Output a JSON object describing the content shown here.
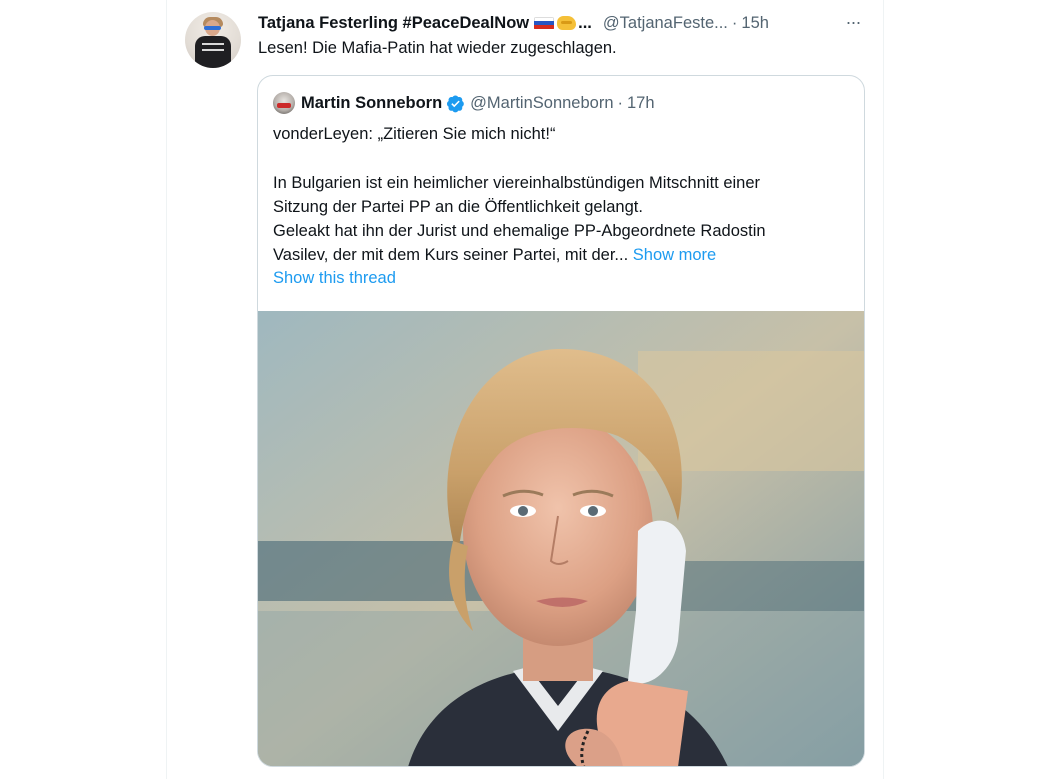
{
  "tweet": {
    "author": {
      "display_name": "Tatjana Festerling #PeaceDealNow",
      "name_emoji": [
        "russia-flag",
        "handshake"
      ],
      "name_truncation": "...",
      "handle": "@TatjanaFeste...",
      "separator": "·",
      "time": "15h"
    },
    "more_icon": "···",
    "text": "Lesen! Die Mafia-Patin hat wieder zugeschlagen."
  },
  "quoted_tweet": {
    "author": {
      "display_name": "Martin Sonneborn",
      "verified": true,
      "handle": "@MartinSonneborn",
      "separator": "·",
      "time": "17h"
    },
    "lines": [
      "vonderLeyen: „Zitieren Sie mich nicht!“",
      "",
      "In Bulgarien ist ein heimlicher viereinhalbstündigen Mitschnitt einer",
      "Sitzung der Partei PP an die Öffentlichkeit gelangt.",
      "Geleakt hat ihn der Jurist und ehemalige PP-Abgeordnete Radostin",
      "Vasilev, der mit dem Kurs seiner Partei, mit der..."
    ],
    "show_more_label": "Show more",
    "show_thread_label": "Show this thread",
    "image_description": "photo-woman-on-phone"
  },
  "colors": {
    "link": "#1d9bf0",
    "secondary_text": "#536471",
    "border": "#cfd9de",
    "verified": "#1d9bf0"
  }
}
